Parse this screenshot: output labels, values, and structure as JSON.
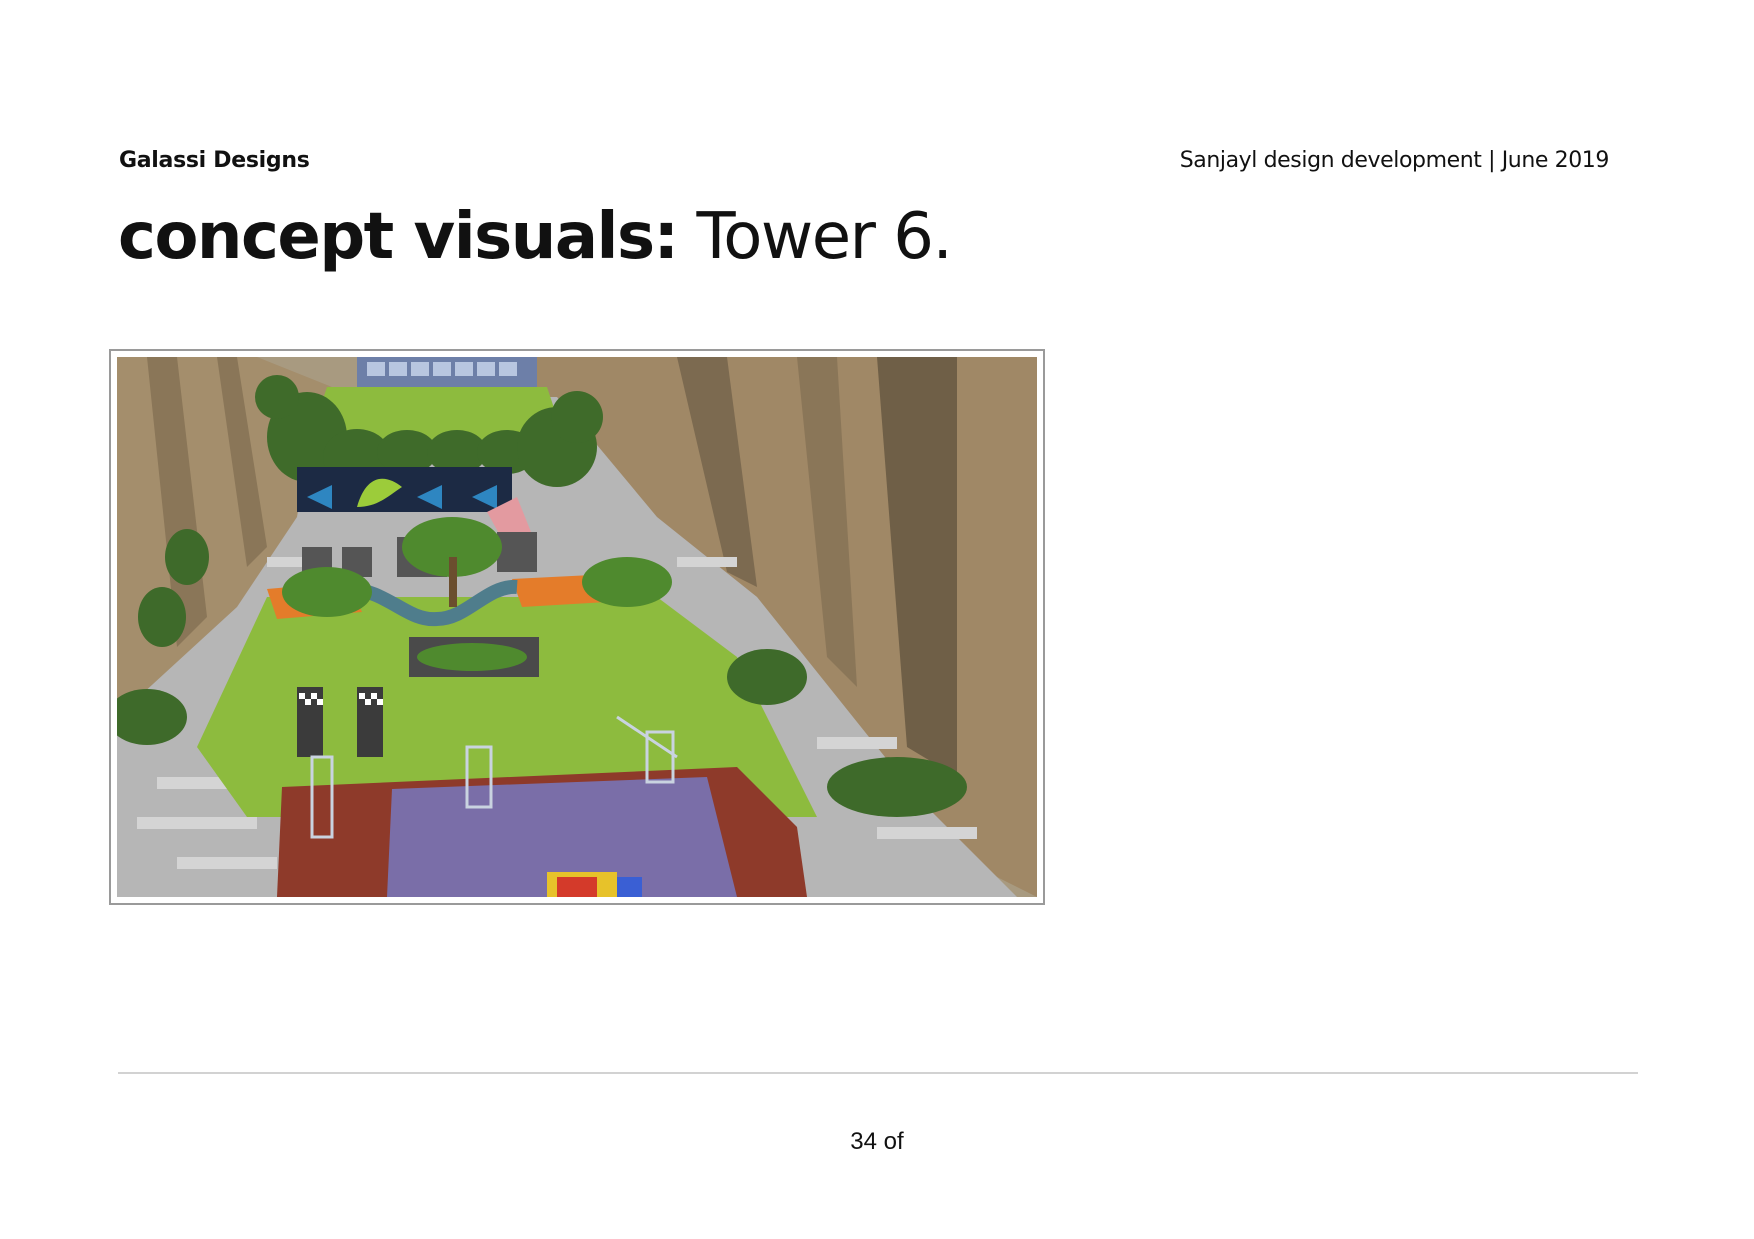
{
  "header": {
    "company": "Galassi Designs",
    "doc_info": "Sanjayl design development | June 2019"
  },
  "title": {
    "bold": "concept visuals:",
    "light": " Tower 6."
  },
  "visual": {
    "subject": "courtyard-render",
    "colors": {
      "wall": "#9b8a6e",
      "wall_shadow": "#6f6350",
      "lawn": "#8dbb3e",
      "paving": "#b9b9b9",
      "rubber_mulch": "#8e3a2a",
      "play_surface": "#7a6ea8",
      "accent_orange": "#e47c2a",
      "mural": "#1c2a44"
    }
  },
  "footer": {
    "page_label": "34 of"
  }
}
